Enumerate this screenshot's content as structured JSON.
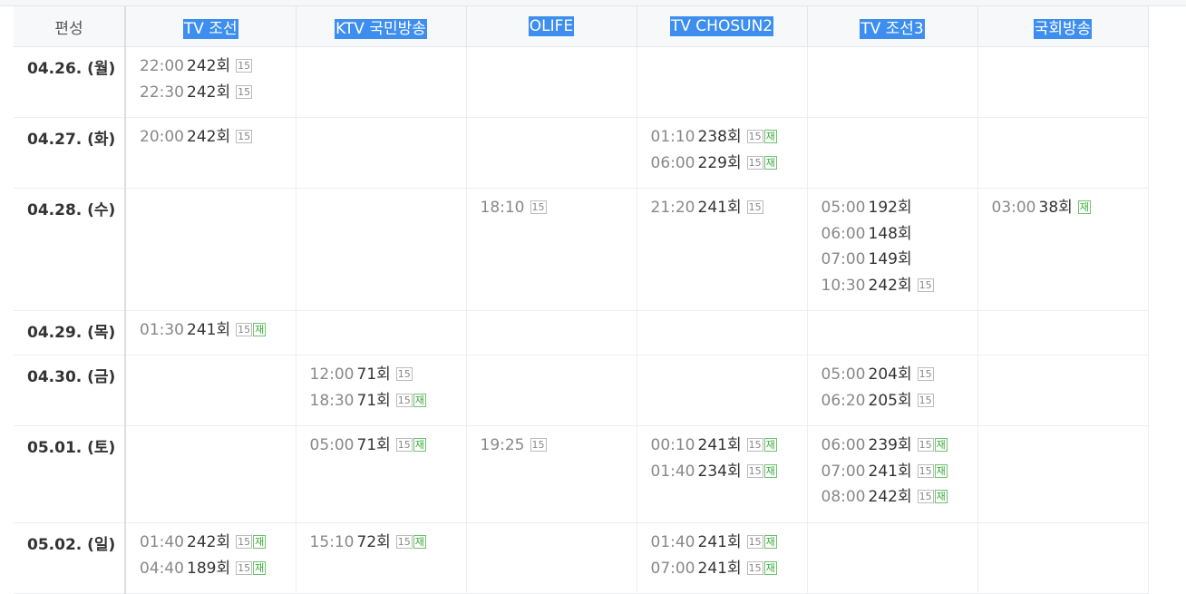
{
  "header": {
    "corner": "편성",
    "channels": [
      "TV 조선",
      "KTV 국민방송",
      "OLIFE",
      "TV CHOSUN2",
      "TV 조선3",
      "국회방송"
    ]
  },
  "labels": {
    "rating": "15",
    "rerun": "재"
  },
  "rows": [
    {
      "date": "04.26. (월)",
      "height": 78,
      "cells": [
        [
          {
            "time": "22:00",
            "ep": "242회",
            "rating": true,
            "rerun": false
          },
          {
            "time": "22:30",
            "ep": "242회",
            "rating": true,
            "rerun": false
          }
        ],
        [],
        [],
        [],
        [],
        []
      ]
    },
    {
      "date": "04.27. (화)",
      "height": 78,
      "cells": [
        [
          {
            "time": "20:00",
            "ep": "242회",
            "rating": true,
            "rerun": false
          }
        ],
        [],
        [],
        [
          {
            "time": "01:10",
            "ep": "238회",
            "rating": true,
            "rerun": true
          },
          {
            "time": "06:00",
            "ep": "229회",
            "rating": true,
            "rerun": true
          }
        ],
        [],
        []
      ]
    },
    {
      "date": "04.28. (수)",
      "height": 135,
      "cells": [
        [],
        [],
        [
          {
            "time": "18:10",
            "ep": "",
            "rating": true,
            "rerun": false
          }
        ],
        [
          {
            "time": "21:20",
            "ep": "241회",
            "rating": true,
            "rerun": false
          }
        ],
        [
          {
            "time": "05:00",
            "ep": "192회",
            "rating": false,
            "rerun": false
          },
          {
            "time": "06:00",
            "ep": "148회",
            "rating": false,
            "rerun": false
          },
          {
            "time": "07:00",
            "ep": "149회",
            "rating": false,
            "rerun": false
          },
          {
            "time": "10:30",
            "ep": "242회",
            "rating": true,
            "rerun": false
          }
        ],
        [
          {
            "time": "03:00",
            "ep": "38회",
            "rating": false,
            "rerun": true
          }
        ]
      ]
    },
    {
      "date": "04.29. (목)",
      "height": 49,
      "cells": [
        [
          {
            "time": "01:30",
            "ep": "241회",
            "rating": true,
            "rerun": true
          }
        ],
        [],
        [],
        [],
        [],
        []
      ]
    },
    {
      "date": "04.30. (금)",
      "height": 78,
      "cells": [
        [],
        [
          {
            "time": "12:00",
            "ep": "71회",
            "rating": true,
            "rerun": false
          },
          {
            "time": "18:30",
            "ep": "71회",
            "rating": true,
            "rerun": true
          }
        ],
        [],
        [],
        [
          {
            "time": "05:00",
            "ep": "204회",
            "rating": true,
            "rerun": false
          },
          {
            "time": "06:20",
            "ep": "205회",
            "rating": true,
            "rerun": false
          }
        ],
        []
      ]
    },
    {
      "date": "05.01. (토)",
      "height": 107,
      "cells": [
        [],
        [
          {
            "time": "05:00",
            "ep": "71회",
            "rating": true,
            "rerun": true
          }
        ],
        [
          {
            "time": "19:25",
            "ep": "",
            "rating": true,
            "rerun": false
          }
        ],
        [
          {
            "time": "00:10",
            "ep": "241회",
            "rating": true,
            "rerun": true
          },
          {
            "time": "01:40",
            "ep": "234회",
            "rating": true,
            "rerun": true
          }
        ],
        [
          {
            "time": "06:00",
            "ep": "239회",
            "rating": true,
            "rerun": true
          },
          {
            "time": "07:00",
            "ep": "241회",
            "rating": true,
            "rerun": true
          },
          {
            "time": "08:00",
            "ep": "242회",
            "rating": true,
            "rerun": true
          }
        ],
        []
      ]
    },
    {
      "date": "05.02. (일)",
      "height": 78,
      "cells": [
        [
          {
            "time": "01:40",
            "ep": "242회",
            "rating": true,
            "rerun": true
          },
          {
            "time": "04:40",
            "ep": "189회",
            "rating": true,
            "rerun": true
          }
        ],
        [
          {
            "time": "15:10",
            "ep": "72회",
            "rating": true,
            "rerun": true
          }
        ],
        [],
        [
          {
            "time": "01:40",
            "ep": "241회",
            "rating": true,
            "rerun": true
          },
          {
            "time": "07:00",
            "ep": "241회",
            "rating": true,
            "rerun": true
          }
        ],
        [],
        []
      ]
    }
  ]
}
